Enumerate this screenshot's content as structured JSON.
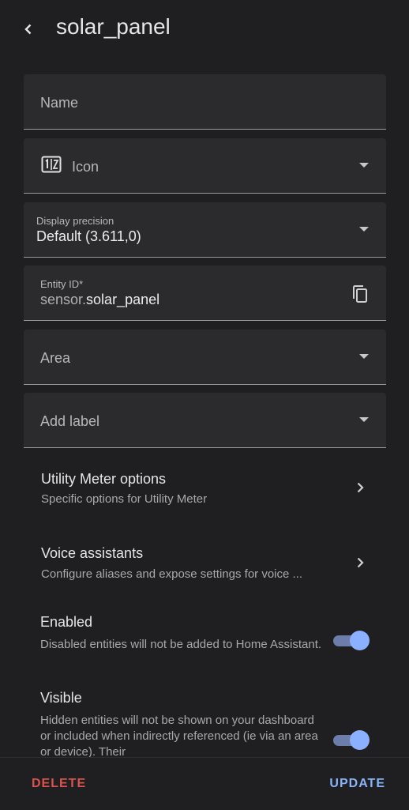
{
  "header": {
    "title": "solar_panel",
    "back_icon": "chevron-left-icon"
  },
  "fields": {
    "name": {
      "placeholder": "Name"
    },
    "icon": {
      "label": "Icon",
      "icon": "numeric-icon"
    },
    "display_precision": {
      "label": "Display precision",
      "value": "Default (3.611,0)"
    },
    "entity_id": {
      "label": "Entity ID*",
      "prefix": "sensor.",
      "value": "solar_panel",
      "copy_icon": "copy-icon"
    },
    "area": {
      "label": "Area"
    },
    "add_label": {
      "label": "Add label"
    }
  },
  "rows": {
    "utility": {
      "title": "Utility Meter options",
      "subtitle": "Specific options for Utility Meter"
    },
    "voice": {
      "title": "Voice assistants",
      "subtitle": "Configure aliases and expose settings for voice ..."
    }
  },
  "toggles": {
    "enabled": {
      "title": "Enabled",
      "subtitle": "Disabled entities will not be added to Home Assistant.",
      "state": "on"
    },
    "visible": {
      "title": "Visible",
      "subtitle": "Hidden entities will not be shown on your dashboard or included when indirectly referenced (ie via an area or device). Their",
      "state": "on"
    }
  },
  "footer": {
    "delete": "DELETE",
    "update": "UPDATE"
  },
  "colors": {
    "accent": "#8ab4f8",
    "danger": "#d9534f",
    "background": "#1f1f21",
    "field": "#2b2b2d"
  }
}
